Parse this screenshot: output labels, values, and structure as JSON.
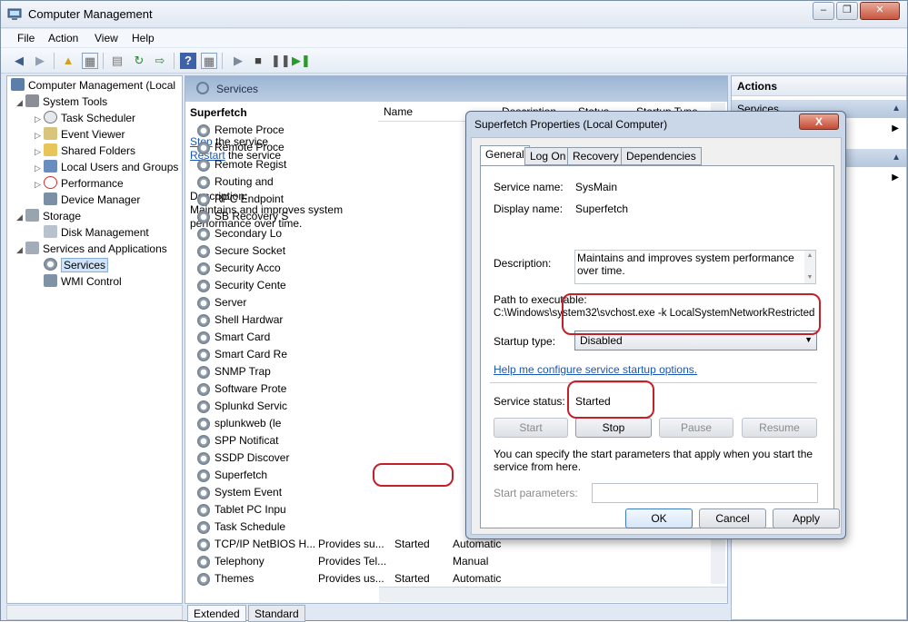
{
  "window": {
    "title": "Computer Management",
    "controls": [
      "minimize",
      "restore",
      "close"
    ]
  },
  "menu": [
    "File",
    "Action",
    "View",
    "Help"
  ],
  "tree": [
    {
      "label": "Computer Management (Local",
      "level": 0,
      "icon": "computer-icon"
    },
    {
      "label": "System Tools",
      "level": 1,
      "icon": "tools-icon"
    },
    {
      "label": "Task Scheduler",
      "level": 2,
      "icon": "clock-icon"
    },
    {
      "label": "Event Viewer",
      "level": 2,
      "icon": "event-viewer-icon"
    },
    {
      "label": "Shared Folders",
      "level": 2,
      "icon": "folder-icon"
    },
    {
      "label": "Local Users and Groups",
      "level": 2,
      "icon": "users-icon"
    },
    {
      "label": "Performance",
      "level": 2,
      "icon": "performance-icon"
    },
    {
      "label": "Device Manager",
      "level": 2,
      "icon": "device-manager-icon"
    },
    {
      "label": "Storage",
      "level": 1,
      "icon": "storage-icon"
    },
    {
      "label": "Disk Management",
      "level": 2,
      "icon": "disk-icon"
    },
    {
      "label": "Services and Applications",
      "level": 1,
      "icon": "services-apps-icon"
    },
    {
      "label": "Services",
      "level": 2,
      "icon": "gear-icon",
      "selected": true
    },
    {
      "label": "WMI Control",
      "level": 2,
      "icon": "wmi-icon"
    }
  ],
  "center": {
    "header": "Services",
    "service_title": "Superfetch",
    "stop_link": "Stop",
    "stop_rest": " the service",
    "restart_link": "Restart",
    "restart_rest": " the service",
    "description_label": "Description:",
    "description_text": "Maintains and improves system performance over time.",
    "columns": [
      "Name",
      "Description",
      "Status",
      "Startup Type"
    ],
    "rows": [
      {
        "name": "Remote Proce",
        "desc": "",
        "status": "",
        "startup": ""
      },
      {
        "name": "Remote Proce",
        "desc": "",
        "status": "",
        "startup": ""
      },
      {
        "name": "Remote Regist",
        "desc": "",
        "status": "",
        "startup": ""
      },
      {
        "name": "Routing and",
        "desc": "",
        "status": "",
        "startup": ""
      },
      {
        "name": "RPC Endpoint",
        "desc": "",
        "status": "",
        "startup": ""
      },
      {
        "name": "SB Recovery S",
        "desc": "",
        "status": "",
        "startup": ""
      },
      {
        "name": "Secondary Lo",
        "desc": "",
        "status": "",
        "startup": ""
      },
      {
        "name": "Secure Socket",
        "desc": "",
        "status": "",
        "startup": ""
      },
      {
        "name": "Security Acco",
        "desc": "",
        "status": "",
        "startup": ""
      },
      {
        "name": "Security Cente",
        "desc": "",
        "status": "",
        "startup": ""
      },
      {
        "name": "Server",
        "desc": "",
        "status": "",
        "startup": ""
      },
      {
        "name": "Shell Hardwar",
        "desc": "",
        "status": "",
        "startup": ""
      },
      {
        "name": "Smart Card",
        "desc": "",
        "status": "",
        "startup": ""
      },
      {
        "name": "Smart Card Re",
        "desc": "",
        "status": "",
        "startup": ""
      },
      {
        "name": "SNMP Trap",
        "desc": "",
        "status": "",
        "startup": ""
      },
      {
        "name": "Software Prote",
        "desc": "",
        "status": "",
        "startup": ""
      },
      {
        "name": "Splunkd Servic",
        "desc": "",
        "status": "",
        "startup": ""
      },
      {
        "name": "splunkweb (le",
        "desc": "",
        "status": "",
        "startup": ""
      },
      {
        "name": "SPP Notificat",
        "desc": "",
        "status": "",
        "startup": ""
      },
      {
        "name": "SSDP Discover",
        "desc": "",
        "status": "",
        "startup": ""
      },
      {
        "name": "Superfetch",
        "desc": "",
        "status": "",
        "startup": ""
      },
      {
        "name": "System Event",
        "desc": "",
        "status": "",
        "startup": ""
      },
      {
        "name": "Tablet PC Inpu",
        "desc": "",
        "status": "",
        "startup": ""
      },
      {
        "name": "Task Schedule",
        "desc": "",
        "status": "",
        "startup": ""
      },
      {
        "name": "TCP/IP NetBIOS H...",
        "desc": "Provides su...",
        "status": "Started",
        "startup": "Automatic"
      },
      {
        "name": "Telephony",
        "desc": "Provides Tel...",
        "status": "",
        "startup": "Manual"
      },
      {
        "name": "Themes",
        "desc": "Provides us...",
        "status": "Started",
        "startup": "Automatic"
      }
    ],
    "bottom_tabs": [
      "Extended",
      "Standard"
    ]
  },
  "actions": {
    "header": "Actions",
    "section1": "Services",
    "section2": ""
  },
  "dialog": {
    "title": "Superfetch Properties (Local Computer)",
    "close": "X",
    "tabs": [
      "General",
      "Log On",
      "Recovery",
      "Dependencies"
    ],
    "service_name_label": "Service name:",
    "service_name": "SysMain",
    "display_name_label": "Display name:",
    "display_name": "Superfetch",
    "description_label": "Description:",
    "description": "Maintains and improves system performance over time.",
    "path_label": "Path to executable:",
    "path": "C:\\Windows\\system32\\svchost.exe -k LocalSystemNetworkRestricted",
    "startup_type_label": "Startup type:",
    "startup_type": "Disabled",
    "help_link": "Help me configure service startup options.",
    "status_label": "Service status:",
    "status": "Started",
    "buttons": {
      "start": "Start",
      "stop": "Stop",
      "pause": "Pause",
      "resume": "Resume"
    },
    "params_note": "You can specify the start parameters that apply when you start the service from here.",
    "params_label": "Start parameters:",
    "params_value": "",
    "ok": "OK",
    "cancel": "Cancel",
    "apply": "Apply"
  },
  "colors": {
    "highlight": "#c4202a",
    "link": "#1a56b8",
    "header_blue": "#9bb5d2"
  }
}
